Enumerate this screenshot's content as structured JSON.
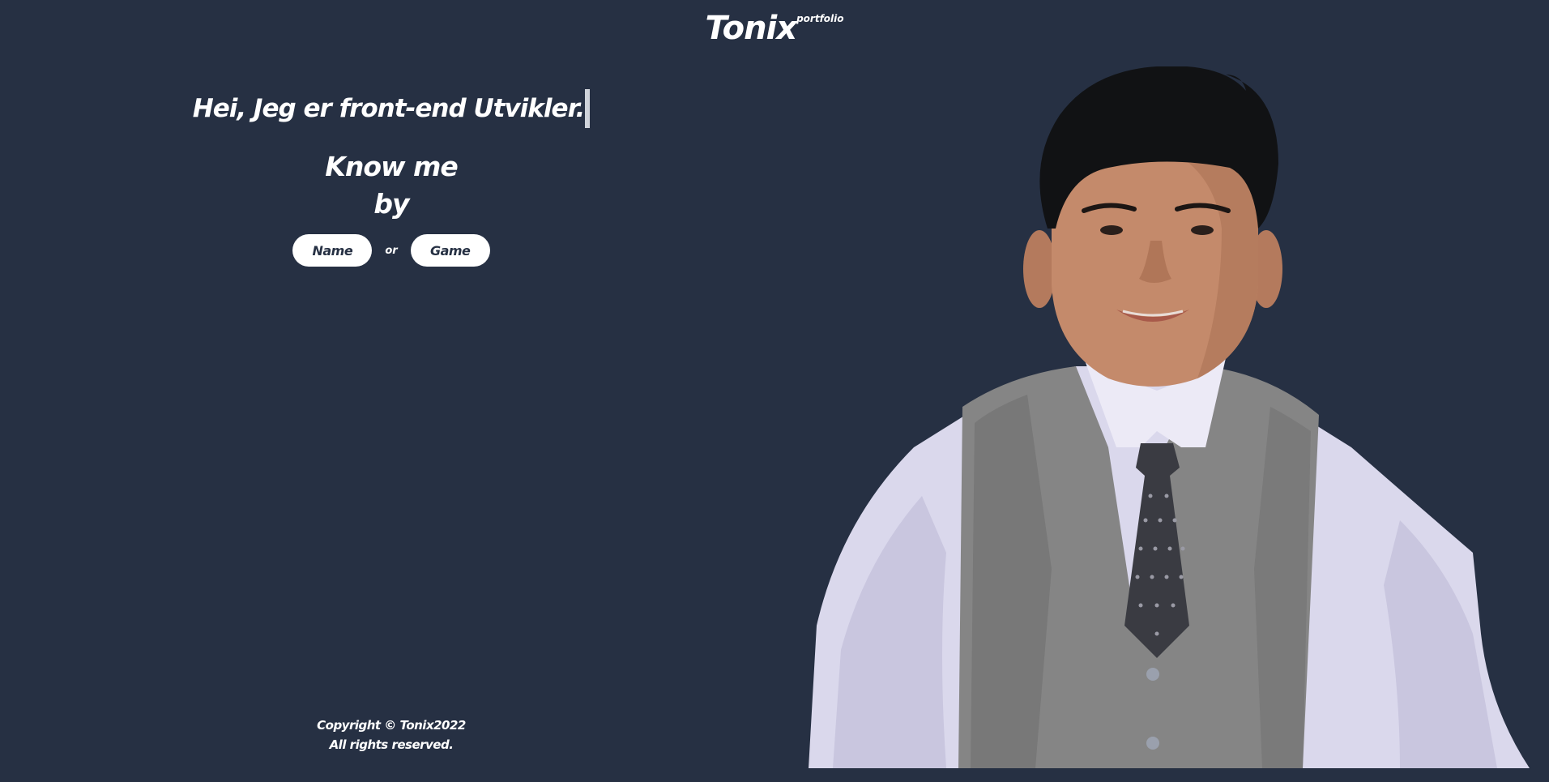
{
  "header": {
    "logo": "Tonix",
    "logo_sup": "portfolio"
  },
  "hero": {
    "headline": "Hei, Jeg er front-end Utvikler.",
    "know_line1": "Know me",
    "know_line2": "by",
    "name_button": "Name",
    "or_text": "or",
    "game_button": "Game"
  },
  "footer": {
    "copyright": "Copyright © Tonix2022",
    "rights": "All rights reserved."
  },
  "colors": {
    "background": "#263043",
    "text": "#ffffff",
    "button_bg": "#ffffff",
    "button_text": "#263043",
    "caret": "#cfd3da"
  }
}
